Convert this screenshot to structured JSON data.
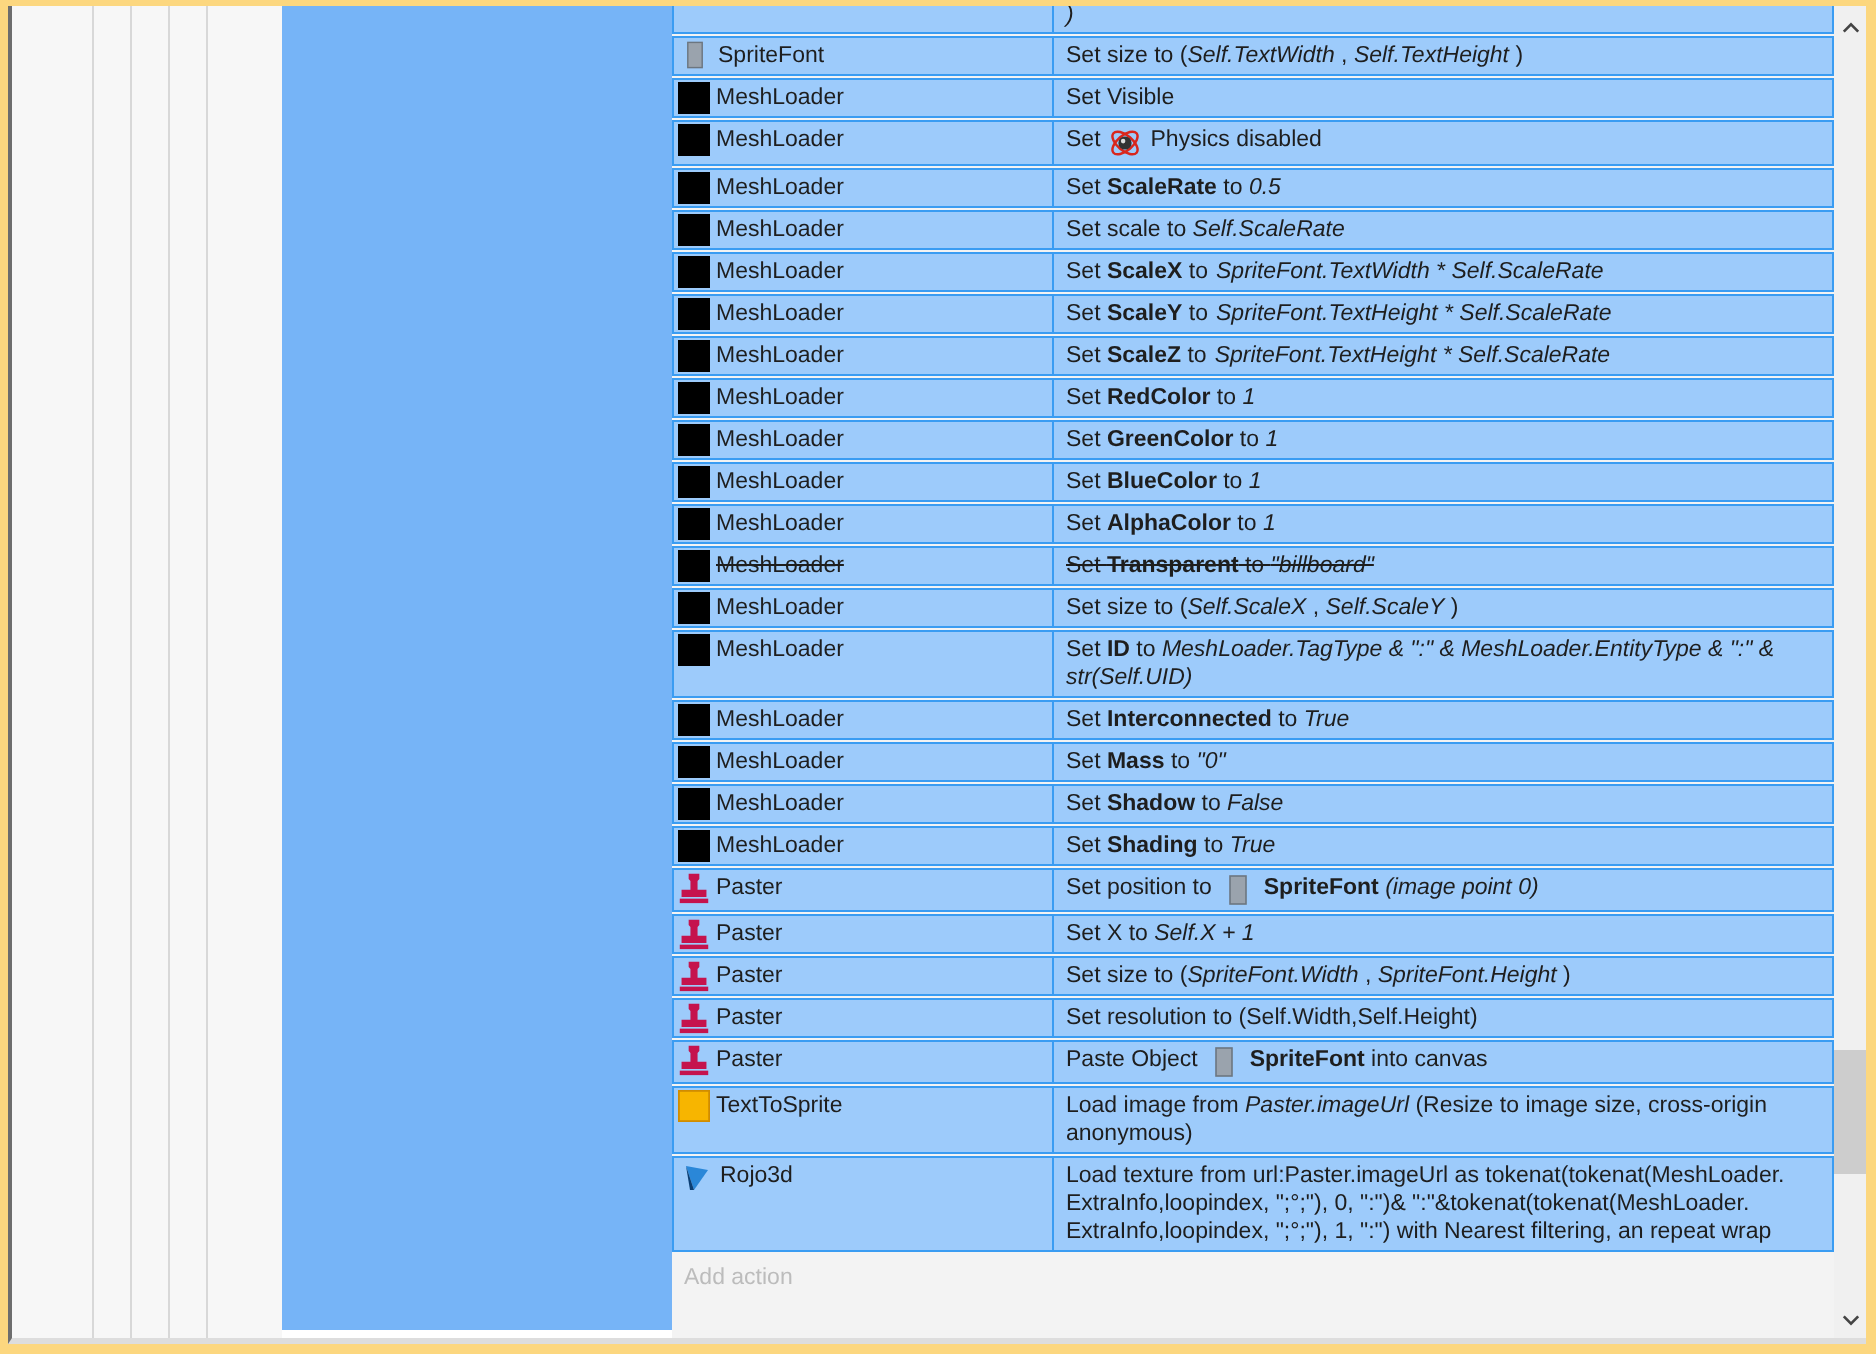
{
  "cut_row": {
    "action": ")"
  },
  "rows": [
    {
      "kind": "spritefont",
      "object": "SpriteFont",
      "disabled": false,
      "action": [
        {
          "kind": "text",
          "text": "Set size to (*Self.TextWidth* , *Self.TextHeight* )"
        }
      ]
    },
    {
      "kind": "meshloader",
      "object": "MeshLoader",
      "disabled": false,
      "action": [
        {
          "kind": "text",
          "text": "Set Visible"
        }
      ]
    },
    {
      "kind": "meshloader",
      "object": "MeshLoader",
      "disabled": false,
      "action": [
        {
          "kind": "text",
          "text": "Set"
        },
        {
          "kind": "physics"
        },
        {
          "kind": "text",
          "text": "Physics disabled"
        }
      ]
    },
    {
      "kind": "meshloader",
      "object": "MeshLoader",
      "disabled": false,
      "action": [
        {
          "kind": "text",
          "text": "Set **ScaleRate** to *0.5*"
        }
      ]
    },
    {
      "kind": "meshloader",
      "object": "MeshLoader",
      "disabled": false,
      "action": [
        {
          "kind": "text",
          "text": "Set scale to *Self.ScaleRate*"
        }
      ]
    },
    {
      "kind": "meshloader",
      "object": "MeshLoader",
      "disabled": false,
      "action": [
        {
          "kind": "text",
          "text": "Set **ScaleX** to"
        },
        {
          "kind": "italic",
          "text": "SpriteFont.TextWidth * Self.ScaleRate"
        }
      ]
    },
    {
      "kind": "meshloader",
      "object": "MeshLoader",
      "disabled": false,
      "action": [
        {
          "kind": "text",
          "text": "Set **ScaleY** to"
        },
        {
          "kind": "italic",
          "text": "SpriteFont.TextHeight * Self.ScaleRate"
        }
      ]
    },
    {
      "kind": "meshloader",
      "object": "MeshLoader",
      "disabled": false,
      "action": [
        {
          "kind": "text",
          "text": "Set **ScaleZ** to"
        },
        {
          "kind": "italic",
          "text": "SpriteFont.TextHeight * Self.ScaleRate"
        }
      ]
    },
    {
      "kind": "meshloader",
      "object": "MeshLoader",
      "disabled": false,
      "action": [
        {
          "kind": "text",
          "text": "Set **RedColor** to *1*"
        }
      ]
    },
    {
      "kind": "meshloader",
      "object": "MeshLoader",
      "disabled": false,
      "action": [
        {
          "kind": "text",
          "text": "Set **GreenColor** to *1*"
        }
      ]
    },
    {
      "kind": "meshloader",
      "object": "MeshLoader",
      "disabled": false,
      "action": [
        {
          "kind": "text",
          "text": "Set **BlueColor** to *1*"
        }
      ]
    },
    {
      "kind": "meshloader",
      "object": "MeshLoader",
      "disabled": false,
      "action": [
        {
          "kind": "text",
          "text": "Set **AlphaColor** to *1*"
        }
      ]
    },
    {
      "kind": "meshloader",
      "object": "MeshLoader",
      "disabled": true,
      "action": [
        {
          "kind": "text",
          "text": "Set **Transparent** to *\"billboard\"*"
        }
      ]
    },
    {
      "kind": "meshloader",
      "object": "MeshLoader",
      "disabled": false,
      "action": [
        {
          "kind": "text",
          "text": "Set size to (*Self.ScaleX* , *Self.ScaleY* )"
        }
      ]
    },
    {
      "kind": "meshloader",
      "object": "MeshLoader",
      "disabled": false,
      "action": [
        {
          "kind": "text",
          "text": "Set **ID** to *MeshLoader.TagType & \":\" & MeshLoader.EntityType & \":\" & str(Self.UID)*"
        }
      ]
    },
    {
      "kind": "meshloader",
      "object": "MeshLoader",
      "disabled": false,
      "action": [
        {
          "kind": "text",
          "text": "Set **Interconnected** to *True*"
        }
      ]
    },
    {
      "kind": "meshloader",
      "object": "MeshLoader",
      "disabled": false,
      "action": [
        {
          "kind": "text",
          "text": "Set **Mass** to *\"0\"*"
        }
      ]
    },
    {
      "kind": "meshloader",
      "object": "MeshLoader",
      "disabled": false,
      "action": [
        {
          "kind": "text",
          "text": "Set **Shadow** to *False*"
        }
      ]
    },
    {
      "kind": "meshloader",
      "object": "MeshLoader",
      "disabled": false,
      "action": [
        {
          "kind": "text",
          "text": "Set **Shading** to *True*"
        }
      ]
    },
    {
      "kind": "paster",
      "object": "Paster",
      "disabled": false,
      "action": [
        {
          "kind": "text",
          "text": "Set position to"
        },
        {
          "kind": "sprite"
        },
        {
          "kind": "text",
          "text": "**SpriteFont** *(image point 0)*"
        }
      ]
    },
    {
      "kind": "paster",
      "object": "Paster",
      "disabled": false,
      "action": [
        {
          "kind": "text",
          "text": "Set X to *Self.X + 1*"
        }
      ]
    },
    {
      "kind": "paster",
      "object": "Paster",
      "disabled": false,
      "action": [
        {
          "kind": "text",
          "text": "Set size to (*SpriteFont.Width* , *SpriteFont.Height* )"
        }
      ]
    },
    {
      "kind": "paster",
      "object": "Paster",
      "disabled": false,
      "action": [
        {
          "kind": "text",
          "text": "Set resolution to (Self.Width,Self.Height)"
        }
      ]
    },
    {
      "kind": "paster",
      "object": "Paster",
      "disabled": false,
      "action": [
        {
          "kind": "text",
          "text": "Paste Object"
        },
        {
          "kind": "sprite"
        },
        {
          "kind": "text",
          "text": "**SpriteFont** into canvas"
        }
      ]
    },
    {
      "kind": "texttosprite",
      "object": "TextToSprite",
      "disabled": false,
      "action": [
        {
          "kind": "text",
          "text": "Load image from *Paster.imageUrl*  (Resize to image size, cross-origin anonymous)"
        }
      ]
    },
    {
      "kind": "rojo3d",
      "object": "Rojo3d",
      "disabled": false,
      "action": [
        {
          "kind": "text",
          "text": "Load texture from url:Paster.imageUrl as tokenat(tokenat(MeshLoader. ExtraInfo,loopindex, \";°;\"), 0, \":\")& \":\"&tokenat(tokenat(MeshLoader. ExtraInfo,loopindex, \";°;\"), 1, \":\") with Nearest filtering, an repeat wrap"
        }
      ]
    }
  ],
  "add_action": {
    "label": "Add action"
  }
}
